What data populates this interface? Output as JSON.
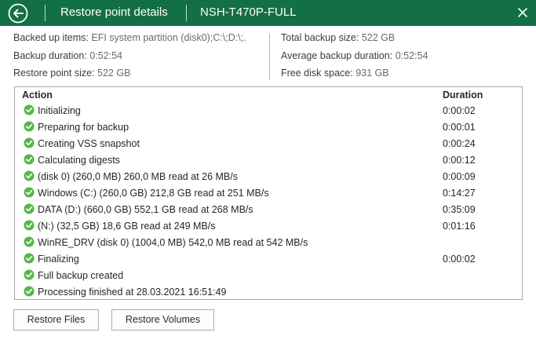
{
  "window": {
    "title": "Restore point details",
    "machine": "NSH-T470P-FULL",
    "accent_color": "#136f45",
    "icons": {
      "back": "back-arrow-circle-icon",
      "close": "close-icon",
      "status": "success-check-icon"
    }
  },
  "summary": {
    "left": [
      {
        "label": "Backed up items:",
        "value": "EFI system partition (disk0);C:\\;D:\\;."
      },
      {
        "label": "Backup duration:",
        "value": "0:52:54"
      },
      {
        "label": "Restore point size:",
        "value": "522 GB"
      }
    ],
    "right": [
      {
        "label": "Total backup size:",
        "value": "522 GB"
      },
      {
        "label": "Average backup duration:",
        "value": "0:52:54"
      },
      {
        "label": "Free disk space:",
        "value": "931 GB"
      }
    ]
  },
  "log": {
    "columns": {
      "action": "Action",
      "duration": "Duration"
    },
    "rows": [
      {
        "action": "Initializing",
        "duration": "0:00:02",
        "status": "success"
      },
      {
        "action": "Preparing for backup",
        "duration": "0:00:01",
        "status": "success"
      },
      {
        "action": "Creating VSS snapshot",
        "duration": "0:00:24",
        "status": "success"
      },
      {
        "action": "Calculating digests",
        "duration": "0:00:12",
        "status": "success"
      },
      {
        "action": " (disk 0) (260,0 MB) 260,0 MB read at 26 MB/s",
        "duration": "0:00:09",
        "status": "success"
      },
      {
        "action": "Windows (C:) (260,0 GB) 212,8 GB read at 251 MB/s",
        "duration": "0:14:27",
        "status": "success"
      },
      {
        "action": "DATA (D:) (660,0 GB) 552,1 GB read at 268 MB/s",
        "duration": "0:35:09",
        "status": "success"
      },
      {
        "action": "(N:) (32,5 GB) 18,6 GB read at 249 MB/s",
        "duration": "0:01:16",
        "status": "success"
      },
      {
        "action": "WinRE_DRV (disk 0) (1004,0 MB) 542,0 MB read at 542 MB/s",
        "duration": "",
        "status": "success"
      },
      {
        "action": "Finalizing",
        "duration": "0:00:02",
        "status": "success"
      },
      {
        "action": "Full backup created",
        "duration": "",
        "status": "success"
      },
      {
        "action": "Processing finished at 28.03.2021 16:51:49",
        "duration": "",
        "status": "success"
      }
    ]
  },
  "buttons": {
    "restore_files": "Restore Files",
    "restore_volumes": "Restore Volumes"
  }
}
